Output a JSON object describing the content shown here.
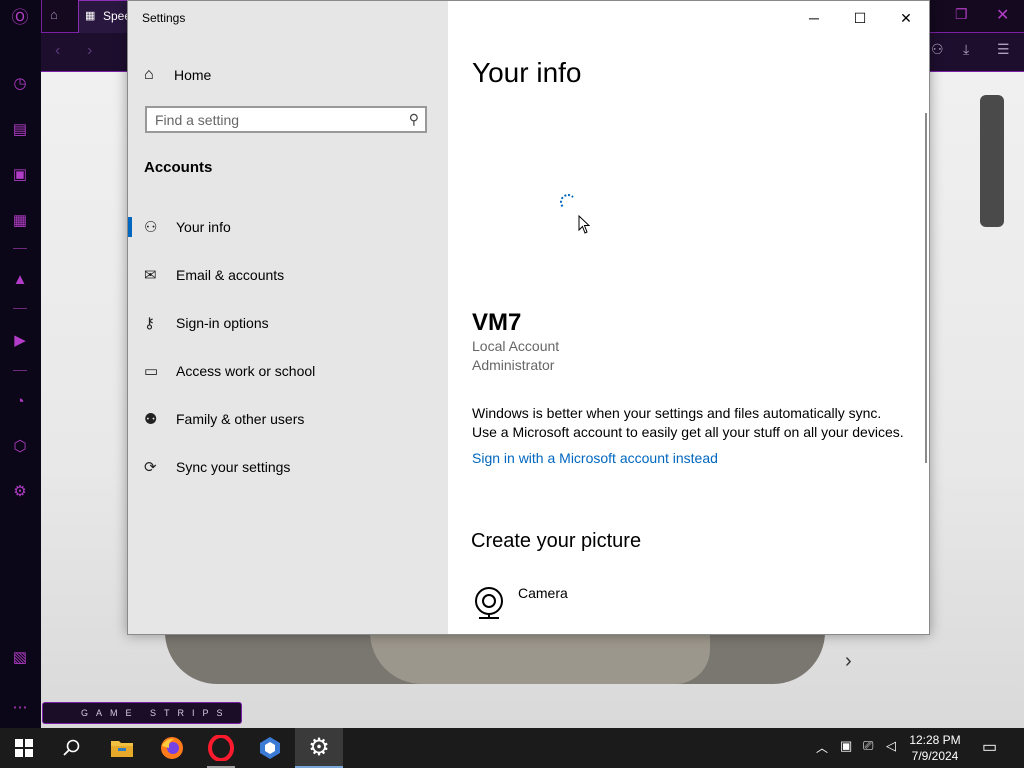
{
  "browser": {
    "tab_label": "Spee",
    "game_strips_label": "GAME STRIPS"
  },
  "settings_window": {
    "title": "Settings",
    "controls": {
      "minimize": "─",
      "maximize": "☐",
      "close": "✕"
    },
    "home_label": "Home",
    "search_placeholder": "Find a setting",
    "section_heading": "Accounts",
    "nav_items": [
      {
        "label": "Your info",
        "icon": "person-list-icon",
        "selected": true
      },
      {
        "label": "Email & accounts",
        "icon": "mail-icon",
        "selected": false
      },
      {
        "label": "Sign-in options",
        "icon": "key-icon",
        "selected": false
      },
      {
        "label": "Access work or school",
        "icon": "briefcase-icon",
        "selected": false
      },
      {
        "label": "Family & other users",
        "icon": "add-person-icon",
        "selected": false
      },
      {
        "label": "Sync your settings",
        "icon": "sync-icon",
        "selected": false
      }
    ],
    "content": {
      "page_title": "Your info",
      "account_name": "VM7",
      "account_type": "Local Account",
      "account_role": "Administrator",
      "sync_message_line1": "Windows is better when your settings and files automatically sync.",
      "sync_message_line2": "Use a Microsoft account to easily get all your stuff on all your devices.",
      "ms_link": "Sign in with a Microsoft account instead",
      "create_picture_heading": "Create your picture",
      "camera_label": "Camera"
    }
  },
  "taskbar": {
    "time": "12:28 PM",
    "date": "7/9/2024",
    "pinned": [
      "start-icon",
      "search-icon",
      "file-explorer-icon",
      "firefox-icon",
      "opera-icon",
      "app-icon",
      "settings-icon"
    ]
  },
  "colors": {
    "accent": "#0067c0",
    "opera_purple": "#b23cc7",
    "taskbar": "#1b1b1b",
    "nav_pane": "#e6e6e6"
  }
}
